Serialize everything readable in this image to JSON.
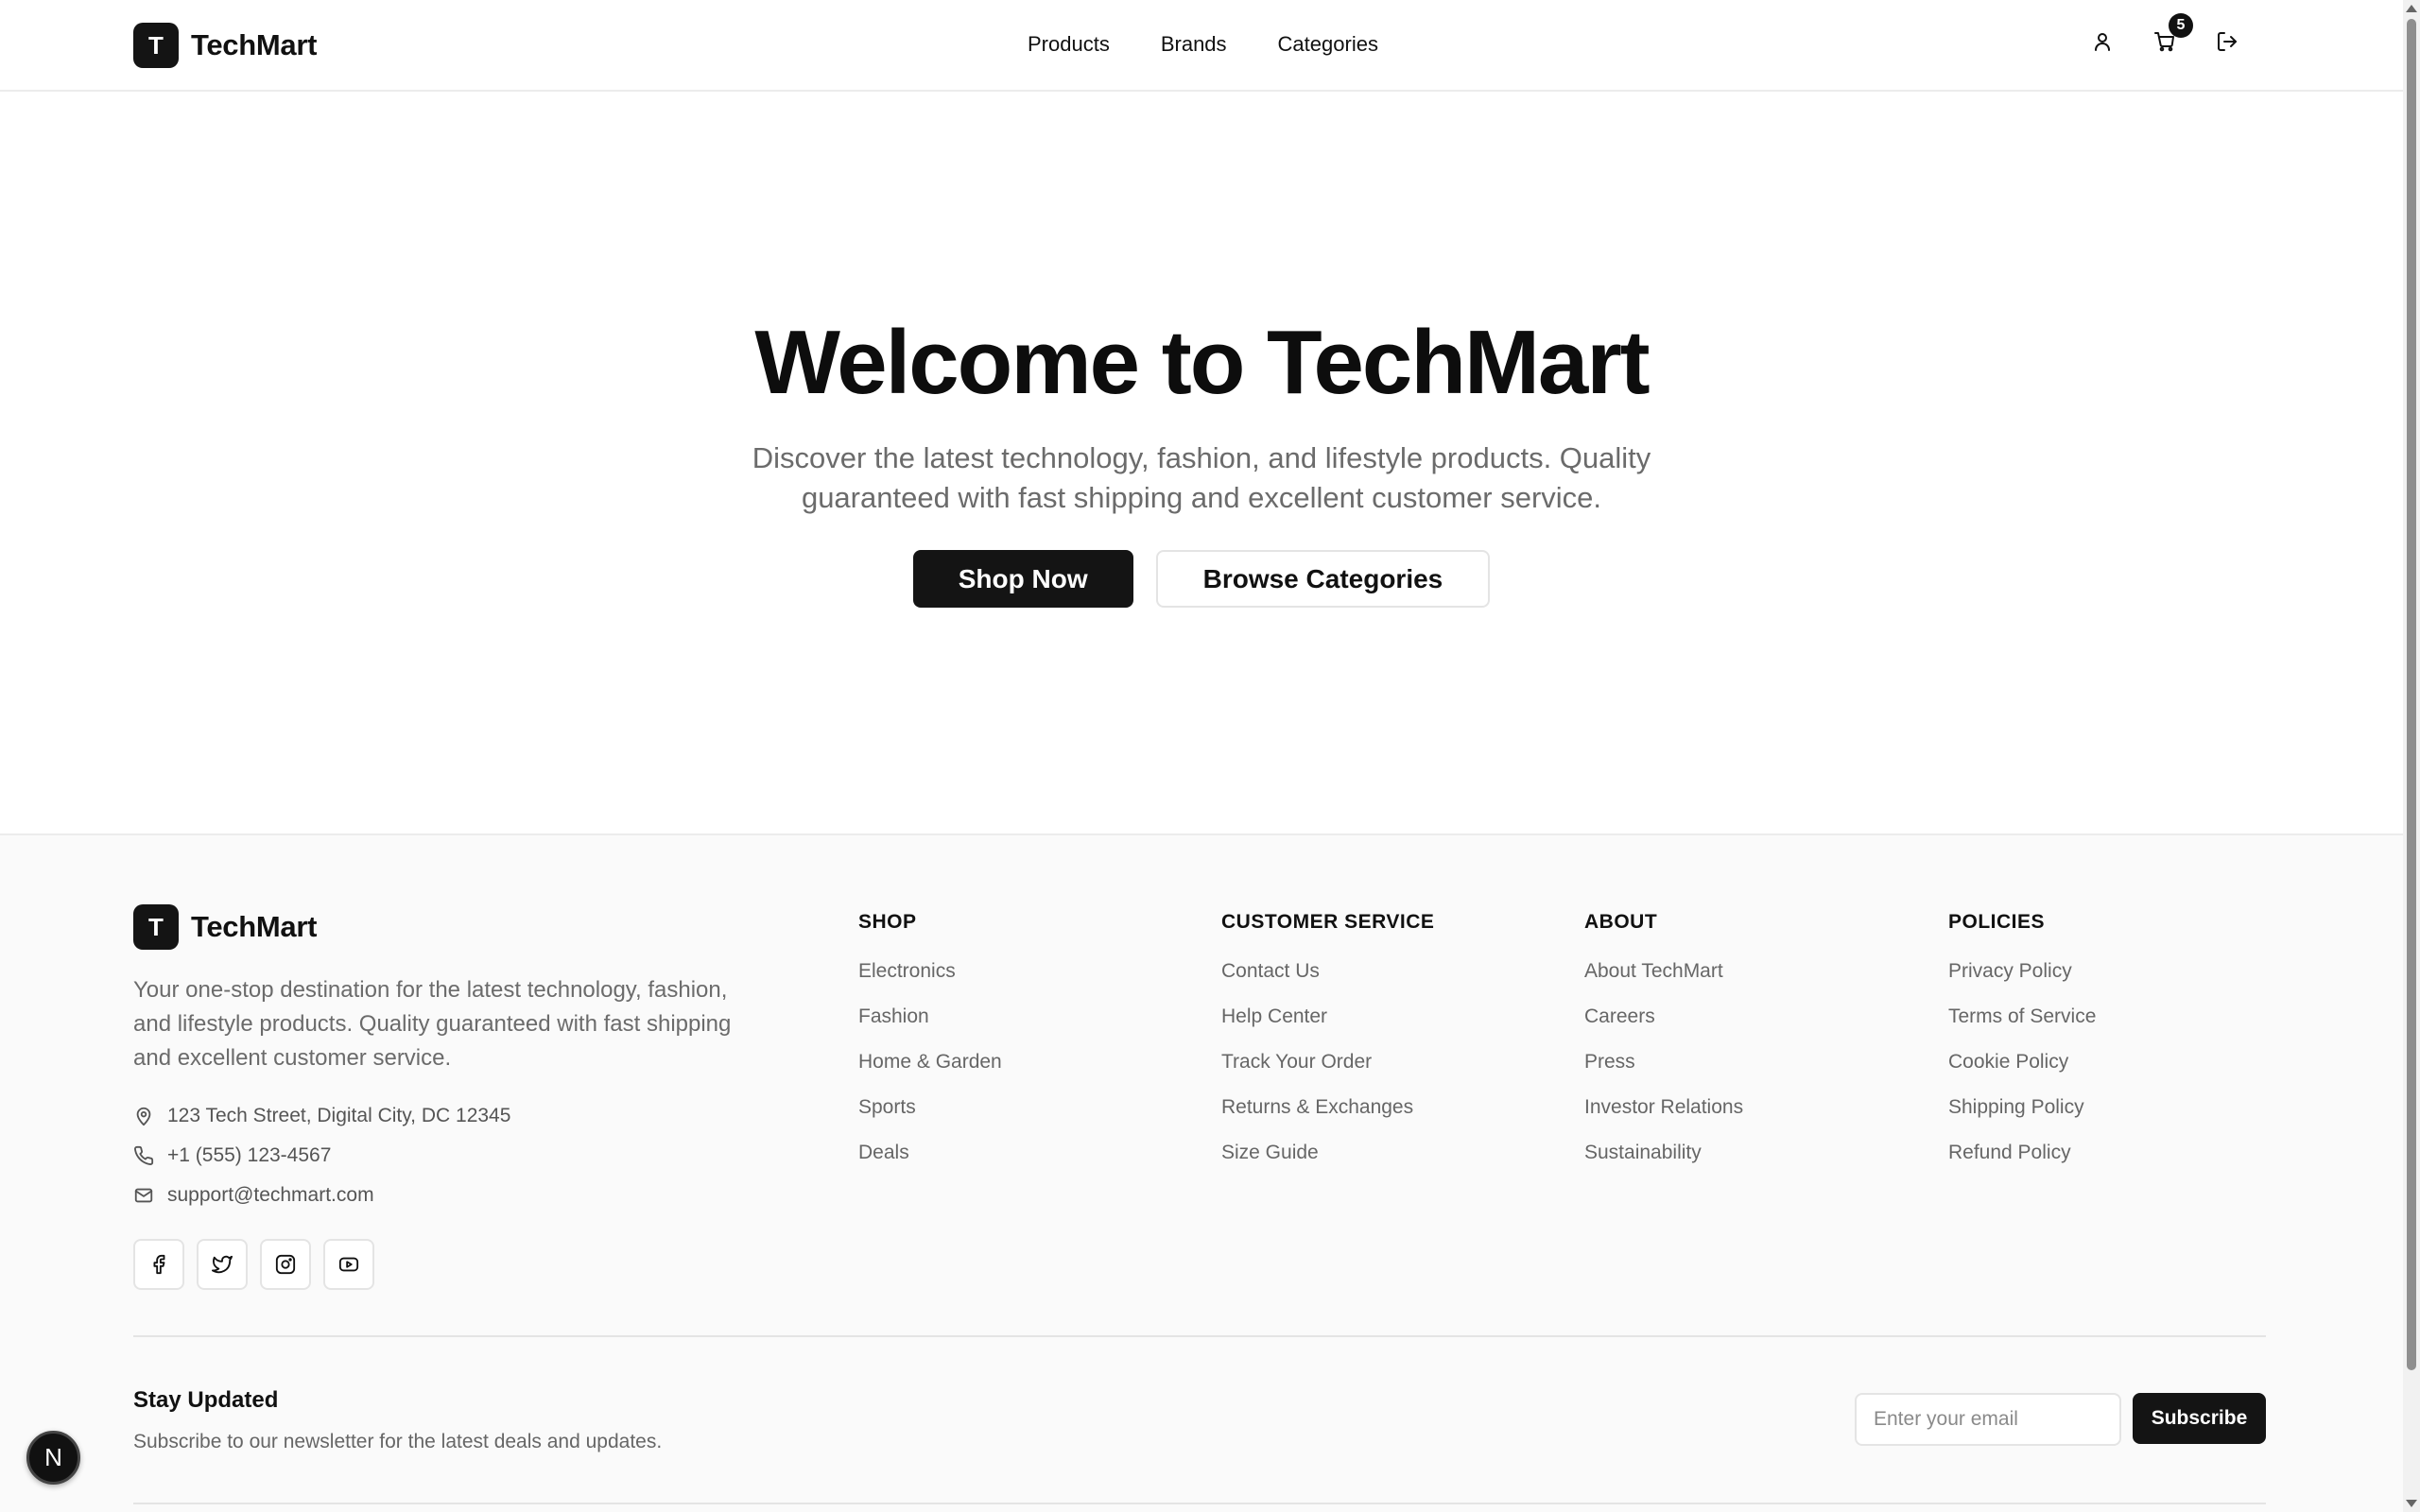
{
  "header": {
    "logo_letter": "T",
    "logo_text": "TechMart",
    "nav": [
      {
        "label": "Products"
      },
      {
        "label": "Brands"
      },
      {
        "label": "Categories"
      }
    ],
    "icons": [
      "user-icon",
      "cart-icon",
      "logout-icon"
    ],
    "cart_count": "5"
  },
  "hero": {
    "title": "Welcome to TechMart",
    "subtitle": "Discover the latest technology, fashion, and lifestyle products. Quality guaranteed with fast shipping and excellent customer service.",
    "primary_button": "Shop Now",
    "secondary_button": "Browse Categories"
  },
  "footer": {
    "logo_letter": "T",
    "logo_text": "TechMart",
    "description": "Your one-stop destination for the latest technology, fashion, and lifestyle products. Quality guaranteed with fast shipping and excellent customer service.",
    "contact": {
      "address": "123 Tech Street, Digital City, DC 12345",
      "phone": "+1 (555) 123-4567",
      "email": "support@techmart.com"
    },
    "socials": [
      "facebook-icon",
      "twitter-icon",
      "instagram-icon",
      "youtube-icon"
    ],
    "columns": [
      {
        "title": "SHOP",
        "links": [
          "Electronics",
          "Fashion",
          "Home & Garden",
          "Sports",
          "Deals"
        ]
      },
      {
        "title": "CUSTOMER SERVICE",
        "links": [
          "Contact Us",
          "Help Center",
          "Track Your Order",
          "Returns & Exchanges",
          "Size Guide"
        ]
      },
      {
        "title": "ABOUT",
        "links": [
          "About TechMart",
          "Careers",
          "Press",
          "Investor Relations",
          "Sustainability"
        ]
      },
      {
        "title": "POLICIES",
        "links": [
          "Privacy Policy",
          "Terms of Service",
          "Cookie Policy",
          "Shipping Policy",
          "Refund Policy"
        ]
      }
    ],
    "newsletter": {
      "title": "Stay Updated",
      "subtitle": "Subscribe to our newsletter for the latest deals and updates.",
      "placeholder": "Enter your email",
      "button": "Subscribe"
    }
  },
  "fab_letter": "N",
  "colors": {
    "primary": "#141414",
    "muted_text": "#6b6b6b",
    "footer_bg": "#fafafa"
  }
}
